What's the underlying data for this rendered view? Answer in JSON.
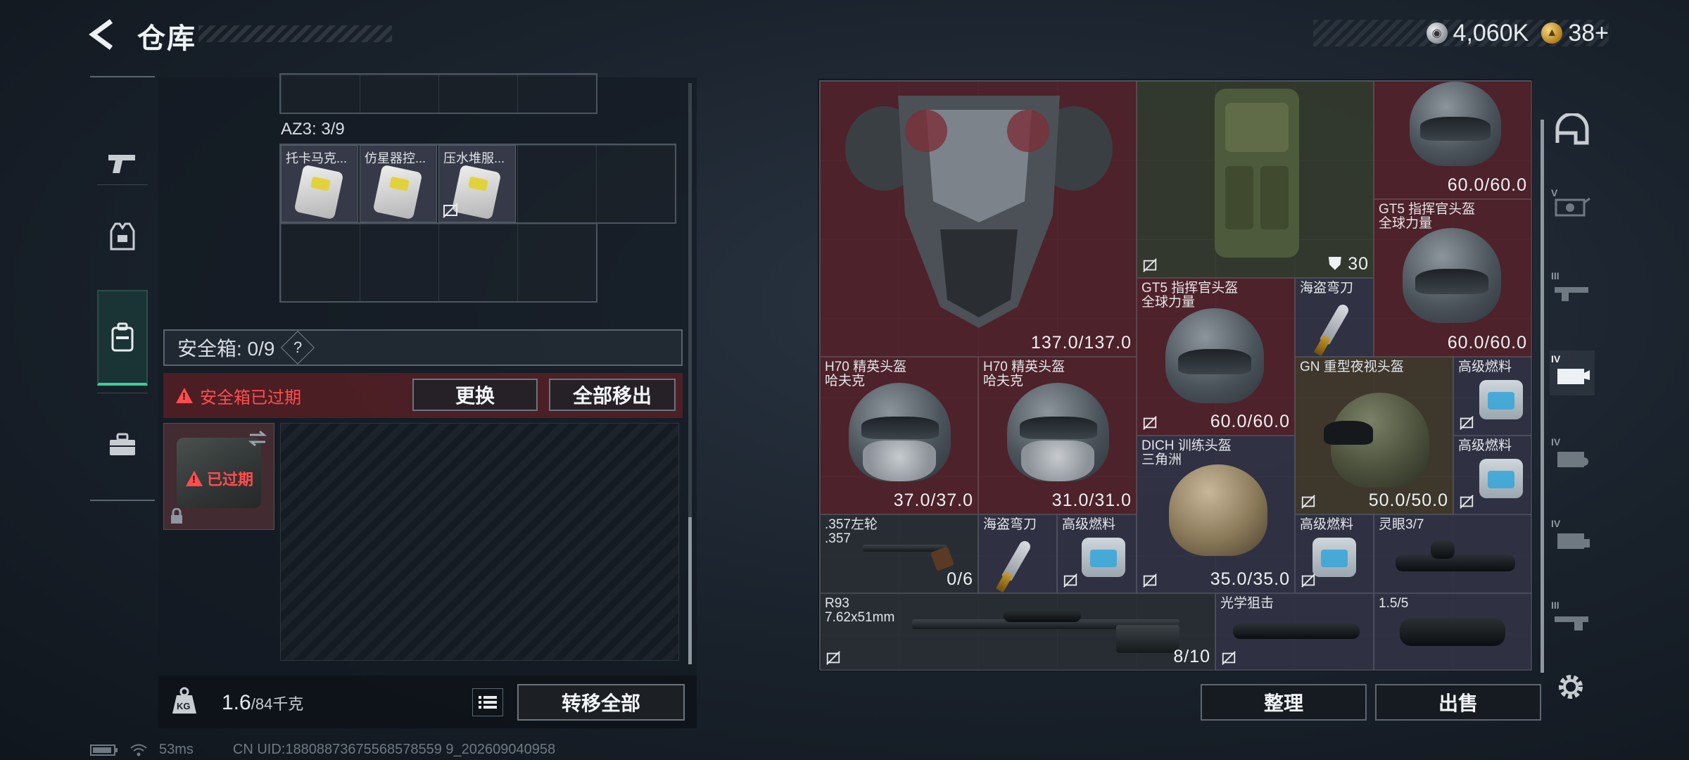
{
  "header": {
    "title": "仓库",
    "currency_silver": "4,060K",
    "currency_gold": "38+"
  },
  "storage": {
    "capacity_label": "AZ3: 3/9",
    "items": [
      {
        "name": "托卡马克..."
      },
      {
        "name": "仿星器控..."
      },
      {
        "name": "压水堆服..."
      }
    ]
  },
  "safe_box": {
    "label": "安全箱: 0/9",
    "help": "?",
    "expired_msg": "安全箱已过期",
    "replace_btn": "更换",
    "move_all_btn": "全部移出",
    "item_status": "已过期"
  },
  "weight": {
    "current": "1.6",
    "max": "/84千克",
    "icon_text": "KG",
    "transfer_all_btn": "转移全部"
  },
  "status_bar": {
    "ping": "53ms",
    "uid": "CN UID:18808873675568578559 9_202609040958"
  },
  "inventory": {
    "items": [
      {
        "key": "armor",
        "value": "137.0/137.0"
      },
      {
        "key": "backpack",
        "value": "30"
      },
      {
        "key": "helmet-top-right",
        "value": "60.0/60.0"
      },
      {
        "key": "gt5-a",
        "name": "GT5 指挥官头盔",
        "sub": "全球力量",
        "value": "60.0/60.0"
      },
      {
        "key": "gt5-b",
        "name": "GT5 指挥官头盔",
        "sub": "全球力量",
        "value": "60.0/60.0"
      },
      {
        "key": "pirate-knife-a",
        "name": "海盗弯刀"
      },
      {
        "key": "h70-a",
        "name": "H70 精英头盔",
        "sub": "哈夫克",
        "value": "37.0/37.0"
      },
      {
        "key": "h70-b",
        "name": "H70 精英头盔",
        "sub": "哈夫克",
        "value": "31.0/31.0"
      },
      {
        "key": "gn-nv",
        "name": "GN 重型夜视头盔",
        "value": "50.0/50.0"
      },
      {
        "key": "fuel-a",
        "name": "高级燃料"
      },
      {
        "key": "fuel-b",
        "name": "高级燃料"
      },
      {
        "key": "dich",
        "name": "DICH 训练头盔",
        "sub": "三角洲",
        "value": "35.0/35.0"
      },
      {
        "key": "revolver",
        "name": ".357左轮",
        "sub": ".357",
        "value": "0/6"
      },
      {
        "key": "pirate-knife-b",
        "name": "海盗弯刀"
      },
      {
        "key": "fuel-c",
        "name": "高级燃料"
      },
      {
        "key": "fuel-d",
        "name": "高级燃料"
      },
      {
        "key": "lingyan",
        "name": "灵眼3/7"
      },
      {
        "key": "r93",
        "name": "R93",
        "sub": "7.62x51mm",
        "value": "8/10"
      },
      {
        "key": "optic-sniper",
        "name": "光学狙击"
      },
      {
        "key": "scope-15",
        "name": "1.5/5"
      }
    ],
    "sort_btn": "整理",
    "sell_btn": "出售"
  },
  "right_filters": {
    "labels": [
      "V",
      "III",
      "IV",
      "IV",
      "IV",
      "III"
    ]
  },
  "colors": {
    "accent_green": "#37d19a",
    "danger_red": "#ff4d4d"
  }
}
